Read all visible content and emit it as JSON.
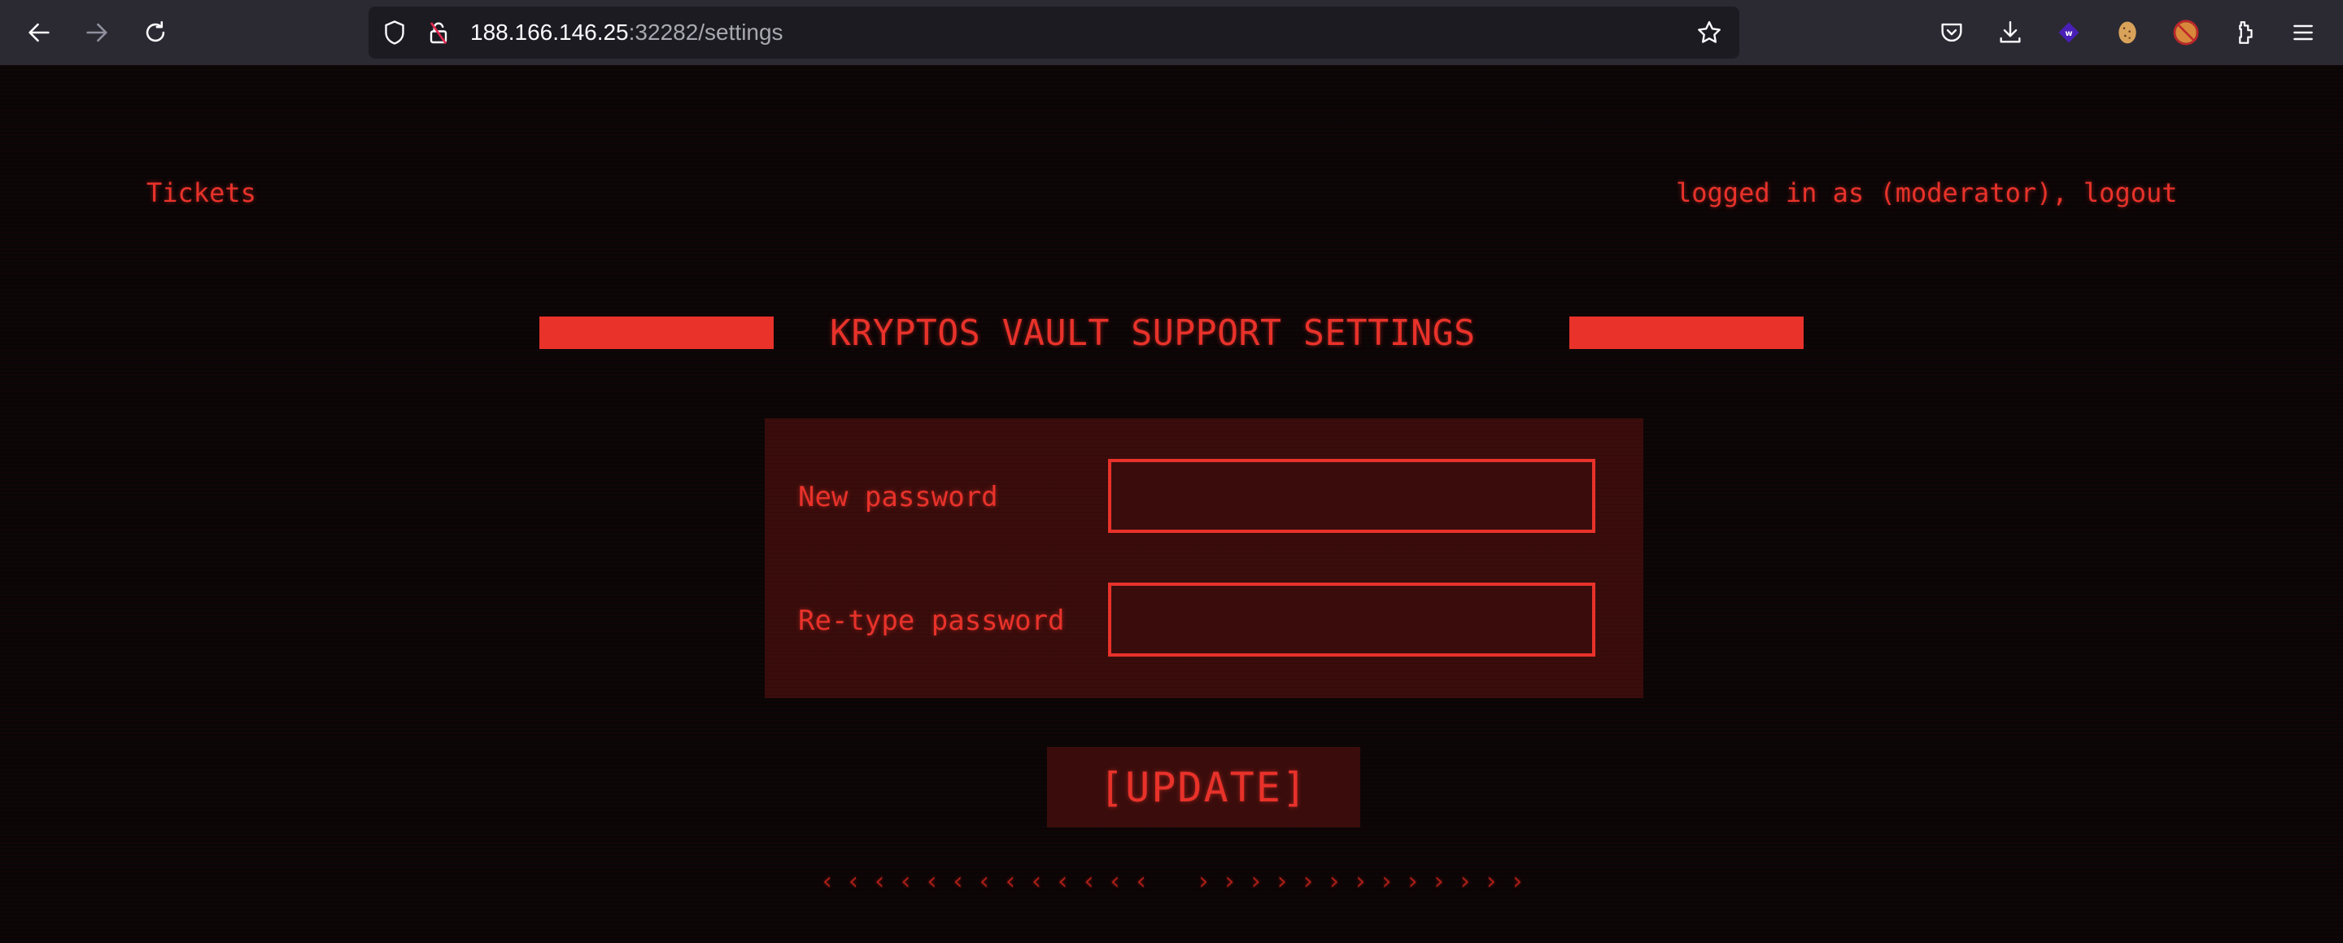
{
  "browser": {
    "url_host": "188.166.146.25",
    "url_rest": ":32282/settings",
    "nav_icons": [
      "back-arrow-icon",
      "forward-arrow-icon",
      "reload-icon"
    ],
    "url_icons": [
      "tracking-protection-shield-icon",
      "insecure-lock-icon"
    ],
    "toolbar_icons": [
      "bookmark-star-icon",
      "pocket-icon",
      "downloads-icon",
      "wappalyzer-extension-icon",
      "cookie-editor-extension-icon",
      "blocked-extension-icon",
      "extensions-puzzle-icon",
      "app-menu-icon"
    ]
  },
  "header": {
    "tickets_link": "Tickets",
    "login_prefix": "logged in as (moderator), ",
    "logout_link": "logout"
  },
  "main": {
    "title": "KRYPTOS VAULT SUPPORT SETTINGS",
    "form": {
      "new_password_label": "New password",
      "new_password_value": "",
      "retype_password_label": "Re-type password",
      "retype_password_value": "",
      "submit_label": "[UPDATE]"
    },
    "decor": {
      "left_chevron": "‹",
      "right_chevron": "›",
      "chevron_count": 13
    }
  },
  "colors": {
    "accent": "#e8322a",
    "panel_bg": "#3a0d0c",
    "page_bg": "#0a0506",
    "toolbar_bg": "#2b2a33",
    "urlbar_bg": "#1c1b22"
  }
}
